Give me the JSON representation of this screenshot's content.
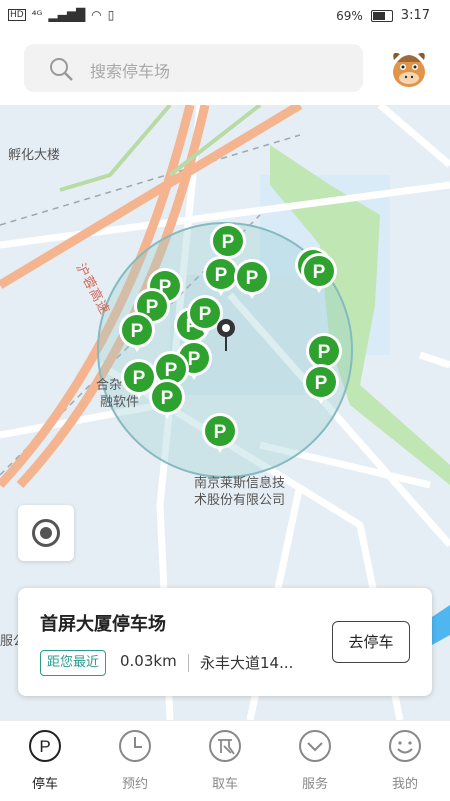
{
  "status_bar": {
    "network": "⁴ᴳ",
    "battery": "69%",
    "time": "3:17"
  },
  "search": {
    "placeholder": "搜索停车场"
  },
  "map": {
    "labels": {
      "incubator": "孵化大楼",
      "highway": "沪蓉高速",
      "company_line1": "南京莱斯信息技",
      "company_line2": "术股份有限公司",
      "left_poi1": "合杂",
      "left_poi2": "融软件",
      "edge_left": "服公"
    },
    "pin_letter": "P"
  },
  "card": {
    "title": "首屏大厦停车场",
    "badge": "距您最近",
    "distance": "0.03km",
    "address": "永丰大道14...",
    "button": "去停车"
  },
  "tabs": [
    {
      "label": "停车",
      "icon": "parking-icon",
      "active": true
    },
    {
      "label": "预约",
      "icon": "clock-icon",
      "active": false
    },
    {
      "label": "取车",
      "icon": "pickup-icon",
      "active": false
    },
    {
      "label": "服务",
      "icon": "chevron-down-icon",
      "active": false
    },
    {
      "label": "我的",
      "icon": "smile-icon",
      "active": false
    }
  ],
  "colors": {
    "pin_green": "#2ea12e",
    "accent_teal": "#2a9d8f",
    "road_orange": "#f3b48f"
  }
}
